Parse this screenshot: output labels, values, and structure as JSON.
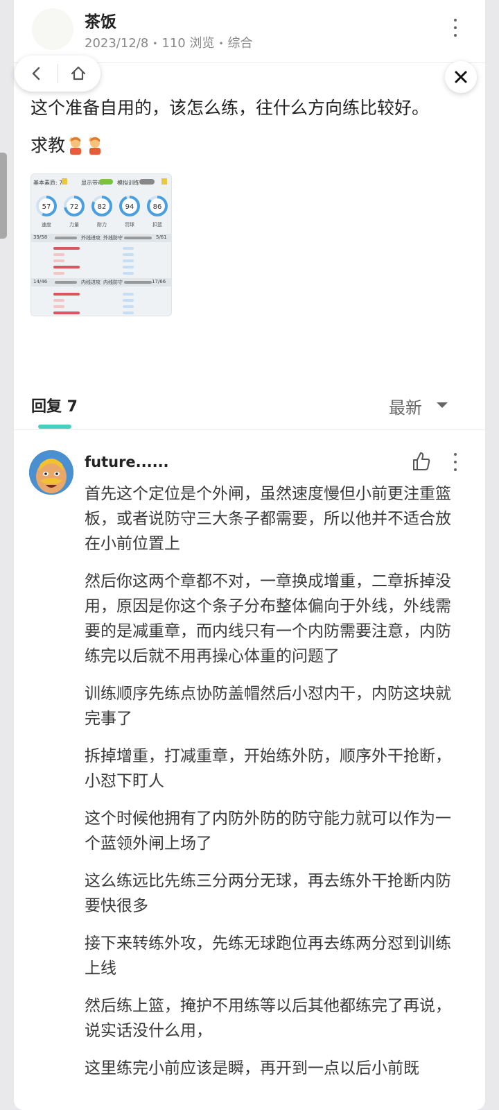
{
  "post": {
    "author": "茶饭",
    "date": "2023/12/8",
    "views": "110 浏览",
    "category": "综合",
    "body_line1": "这个准备自用的，该怎么练，往什么方向练比较好。",
    "body_line2": "求教"
  },
  "image": {
    "top_label_basic": "基本素质: 71",
    "top_label_show": "显示带动",
    "top_label_sim": "模拟训练",
    "gauges": [
      {
        "value": "57",
        "caption": "速度"
      },
      {
        "value": "72",
        "caption": "力量"
      },
      {
        "value": "82",
        "caption": "耐力"
      },
      {
        "value": "94",
        "caption": "罚球"
      },
      {
        "value": "86",
        "caption": "扣篮"
      }
    ],
    "band1_left": "39/58",
    "band1_mid": "外线进攻",
    "band1_mid2": "外线防守",
    "band1_right": "5/61",
    "band2_left": "14/46",
    "band2_mid": "内线进攻",
    "band2_mid2": "内线防守",
    "band2_right": "17/66"
  },
  "replies": {
    "tab_label": "回复 7",
    "sort_label": "最新"
  },
  "comment": {
    "user": "future......",
    "paragraphs": [
      "首先这个定位是个外闸，虽然速度慢但小前更注重篮板，或者说防守三大条子都需要，所以他并不适合放在小前位置上",
      "然后你这两个章都不对，一章换成增重，二章拆掉没用，原因是你这个条子分布整体偏向于外线，外线需要的是减重章，而内线只有一个内防需要注意，内防练完以后就不用再操心体重的问题了",
      "训练顺序先练点协防盖帽然后小怼内干，内防这块就完事了",
      "拆掉增重，打减重章，开始练外防，顺序外干抢断，小怼下盯人",
      "这个时候他拥有了内防外防的防守能力就可以作为一个蓝领外闸上场了",
      "这么练远比先练三分两分无球，再去练外干抢断内防要快很多",
      "接下来转练外攻，先练无球跑位再去练两分怼到训练上线",
      "然后练上篮，掩护不用练等以后其他都练完了再说，说实话没什么用，",
      "这里练完小前应该是瞬，再开到一点以后小前既"
    ]
  },
  "colors": {
    "accent": "#45d0c0",
    "gauge_blue": "#4a9fe0"
  },
  "icons": [
    "back-icon",
    "home-icon",
    "close-icon",
    "more-vertical-icon",
    "thumbs-up-icon",
    "caret-down-icon",
    "raising-hand-emoji"
  ]
}
